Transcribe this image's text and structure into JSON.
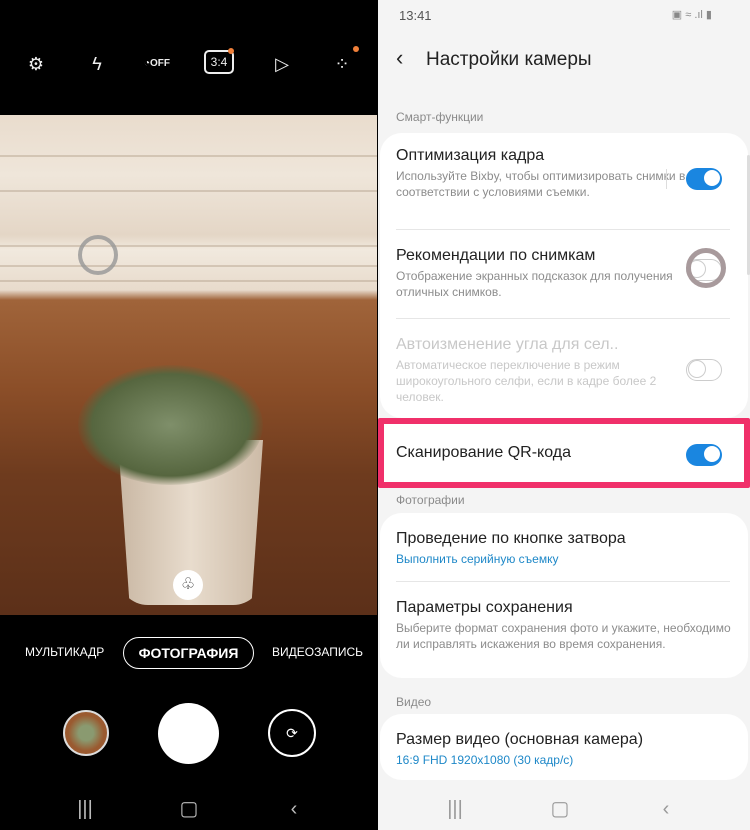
{
  "camera": {
    "toolbar": [
      {
        "icon": "gear-icon",
        "label": ""
      },
      {
        "icon": "flash-off-icon",
        "label": ""
      },
      {
        "icon": "timer-off-icon",
        "label": "OFF"
      },
      {
        "icon": "aspect-ratio-icon",
        "label": "3:4"
      },
      {
        "icon": "motion-photo-icon",
        "label": ""
      },
      {
        "icon": "filter-effects-icon",
        "label": ""
      }
    ],
    "modes": [
      "МУЛЬТИКАДР",
      "ФОТОГРАФИЯ",
      "ВИДЕОЗАПИСЬ"
    ],
    "active_mode": "ФОТОГРАФИЯ",
    "accent": "#f0803a"
  },
  "settings": {
    "status_time": "13:41",
    "title": "Настройки камеры",
    "sections": {
      "smart": "Смарт-функции",
      "photos": "Фотографии",
      "video": "Видео"
    },
    "items": [
      {
        "title": "Оптимизация кадра",
        "desc": "Используйте Bixby, чтобы оптимизировать снимки в соответствии с условиями съемки.",
        "toggle": true
      },
      {
        "title": "Рекомендации по снимкам",
        "desc": "Отображение экранных подсказок для получения отличных снимков.",
        "toggle": false
      },
      {
        "title": "Автоизменение угла для сел..",
        "desc": "Автоматическое переключение в режим широкоугольного селфи, если в кадре более 2 человек.",
        "toggle": false,
        "disabled": true
      },
      {
        "title": "Сканирование QR-кода",
        "toggle": true
      },
      {
        "title": "Проведение по кнопке затвора",
        "value": "Выполнить серийную съемку"
      },
      {
        "title": "Параметры сохранения",
        "desc": "Выберите формат сохранения фото и укажите, необходимо ли исправлять искажения во время сохранения."
      },
      {
        "title": "Размер видео (основная камера)",
        "value": "16:9 FHD 1920x1080 (30 кадр/с)"
      }
    ],
    "highlight_color": "#f0306a",
    "toggle_color": "#1a86e0"
  }
}
